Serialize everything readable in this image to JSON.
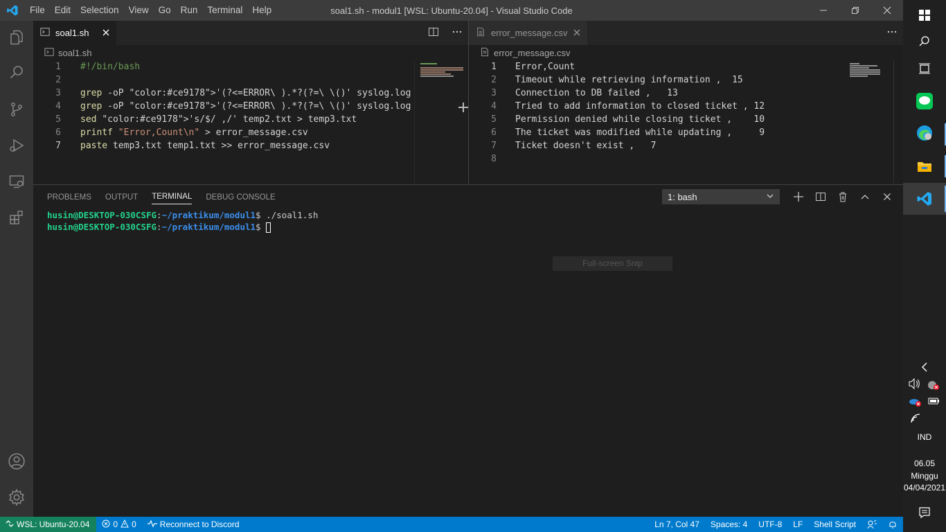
{
  "window": {
    "title": "soal1.sh - modul1 [WSL: Ubuntu-20.04] - Visual Studio Code",
    "menu": [
      "File",
      "Edit",
      "Selection",
      "View",
      "Go",
      "Run",
      "Terminal",
      "Help"
    ]
  },
  "editor_left": {
    "tab_label": "soal1.sh",
    "breadcrumb": "soal1.sh",
    "lines": [
      {
        "n": "1",
        "text": "#!/bin/bash"
      },
      {
        "n": "2",
        "text": ""
      },
      {
        "n": "3",
        "text": "grep -oP '(?<=ERROR\\ ).*?(?=\\ \\()' syslog.log | sort | uniq -c"
      },
      {
        "n": "4",
        "text": "grep -oP '(?<=ERROR\\ ).*?(?=\\ \\()' syslog.log | sort | uniq -c"
      },
      {
        "n": "5",
        "text": "sed 's/$/ ,/' temp2.txt > temp3.txt"
      },
      {
        "n": "6",
        "text": "printf \"Error,Count\\n\" > error_message.csv"
      },
      {
        "n": "7",
        "text": "paste temp3.txt temp1.txt >> error_message.csv"
      }
    ]
  },
  "editor_right": {
    "tab_label": "error_message.csv",
    "breadcrumb": "error_message.csv",
    "lines": [
      {
        "n": "1",
        "text": "Error,Count"
      },
      {
        "n": "2",
        "text": "Timeout while retrieving information ,  15"
      },
      {
        "n": "3",
        "text": "Connection to DB failed ,   13"
      },
      {
        "n": "4",
        "text": "Tried to add information to closed ticket , 12"
      },
      {
        "n": "5",
        "text": "Permission denied while closing ticket ,    10"
      },
      {
        "n": "6",
        "text": "The ticket was modified while updating ,     9"
      },
      {
        "n": "7",
        "text": "Ticket doesn't exist ,   7"
      },
      {
        "n": "8",
        "text": ""
      }
    ]
  },
  "panel": {
    "tabs": [
      "PROBLEMS",
      "OUTPUT",
      "TERMINAL",
      "DEBUG CONSOLE"
    ],
    "terminal_select": "1: bash",
    "terminal_lines": [
      {
        "user": "husin@DESKTOP-030CSFG",
        "sep": ":",
        "path": "~/praktikum/modul1",
        "cmd": "$ ./soal1.sh"
      },
      {
        "user": "husin@DESKTOP-030CSFG",
        "sep": ":",
        "path": "~/praktikum/modul1",
        "cmd": "$ "
      }
    ],
    "snip_overlay": "Full-screen Snip"
  },
  "statusbar": {
    "remote": "WSL: Ubuntu-20.04",
    "errors": "0",
    "warnings": "0",
    "discord": "Reconnect to Discord",
    "position": "Ln 7, Col 47",
    "spaces": "Spaces: 4",
    "encoding": "UTF-8",
    "eol": "LF",
    "language": "Shell Script"
  },
  "taskbar": {
    "language": "IND",
    "time": "06.05",
    "day": "Minggu",
    "date": "04/04/2021"
  },
  "colors": {
    "status_bg": "#007acc",
    "remote_bg": "#16825d",
    "activity_bg": "#333333",
    "editor_bg": "#1e1e1e"
  }
}
